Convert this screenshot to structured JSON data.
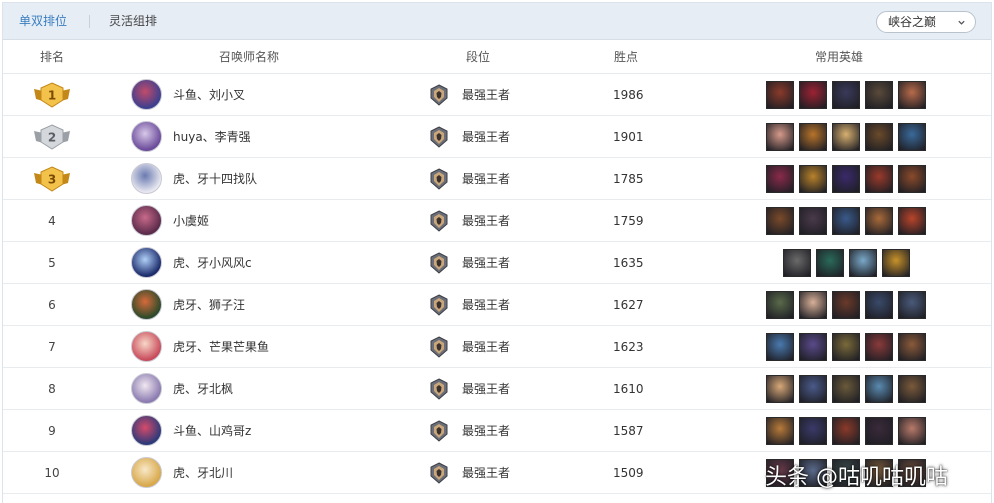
{
  "tabs": [
    {
      "label": "单双排位",
      "active": true
    },
    {
      "label": "灵活组排",
      "active": false
    }
  ],
  "server_select": {
    "value": "峡谷之巅"
  },
  "columns": [
    "排名",
    "召唤师名称",
    "段位",
    "胜点",
    "常用英雄"
  ],
  "colors": {
    "accent": "#3a7ec0",
    "tabbar_bg": "#e6edf5",
    "gold_medal": "#e0a82e",
    "silver_medal": "#b8bcc2"
  },
  "rows": [
    {
      "rank": "1",
      "medal": "gold",
      "name": "斗鱼、刘小叉",
      "tier": "最强王者",
      "points": "1986",
      "avatar": [
        "#3b3f8f",
        "#c24b6a"
      ],
      "champions": [
        "#8a3a2a",
        "#9c2233",
        "#3a3a5a",
        "#5a4a3a",
        "#b86b4a"
      ]
    },
    {
      "rank": "2",
      "medal": "silver",
      "name": "huya、李青强",
      "tier": "最强王者",
      "points": "1901",
      "avatar": [
        "#6a4a9a",
        "#d8c8e8"
      ],
      "champions": [
        "#d69a8a",
        "#b8742a",
        "#d8b070",
        "#6a4a2a",
        "#3a6a9a"
      ]
    },
    {
      "rank": "3",
      "medal": "gold",
      "name": "虎、牙十四找队",
      "tier": "最强王者",
      "points": "1785",
      "avatar": [
        "#e8e8f0",
        "#6a7ab0"
      ],
      "champions": [
        "#8a2a4a",
        "#b8822a",
        "#3a2a6a",
        "#9a3a2a",
        "#8a4a2a"
      ]
    },
    {
      "rank": "4",
      "medal": "",
      "name": "小虞姬",
      "tier": "最强王者",
      "points": "1759",
      "avatar": [
        "#5a2a4a",
        "#c86a8a"
      ],
      "champions": [
        "#7a4a2a",
        "#4a3a4a",
        "#3a5a8a",
        "#a86a3a",
        "#b8442a"
      ]
    },
    {
      "rank": "5",
      "medal": "",
      "name": "虎、牙小风风c",
      "tier": "最强王者",
      "points": "1635",
      "avatar": [
        "#1a2a6a",
        "#b0d0f8"
      ],
      "champions": [
        "#6a6a6a",
        "#2a6a5a",
        "#7aa8c8",
        "#c8922a"
      ]
    },
    {
      "rank": "6",
      "medal": "",
      "name": "虎牙、狮子汪",
      "tier": "最强王者",
      "points": "1627",
      "avatar": [
        "#2a4a2a",
        "#d86a3a"
      ],
      "champions": [
        "#5a6a4a",
        "#d8b098",
        "#6a3a2a",
        "#3a4a6a",
        "#4a5a7a"
      ]
    },
    {
      "rank": "7",
      "medal": "",
      "name": "虎牙、芒果芒果鱼",
      "tier": "最强王者",
      "points": "1623",
      "avatar": [
        "#c84a5a",
        "#f8d8c8"
      ],
      "champions": [
        "#4a7ab0",
        "#5a4a8a",
        "#7a6a3a",
        "#8a3a3a",
        "#8a5a3a"
      ]
    },
    {
      "rank": "8",
      "medal": "",
      "name": "虎、牙北枫",
      "tier": "最强王者",
      "points": "1610",
      "avatar": [
        "#8a7ab0",
        "#f0e8f0"
      ],
      "champions": [
        "#d8a878",
        "#4a5a8a",
        "#6a5a3a",
        "#5a8ab0",
        "#7a5a3a"
      ]
    },
    {
      "rank": "9",
      "medal": "",
      "name": "斗鱼、山鸡哥z",
      "tier": "最强王者",
      "points": "1587",
      "avatar": [
        "#2a3a7a",
        "#d84a6a"
      ],
      "champions": [
        "#b87a3a",
        "#3a3a6a",
        "#8a3a2a",
        "#3a2a3a",
        "#b87a6a"
      ]
    },
    {
      "rank": "10",
      "medal": "",
      "name": "虎、牙北川",
      "tier": "最强王者",
      "points": "1509",
      "avatar": [
        "#d8a84a",
        "#f8e8c8"
      ],
      "champions": [
        "#6a3a4a",
        "#5a6a8a",
        "#3a4a4a",
        "#7a5a3a",
        "#6a4a3a"
      ]
    }
  ],
  "watermark": {
    "text": "头条 @咕叽咕叽咕"
  }
}
